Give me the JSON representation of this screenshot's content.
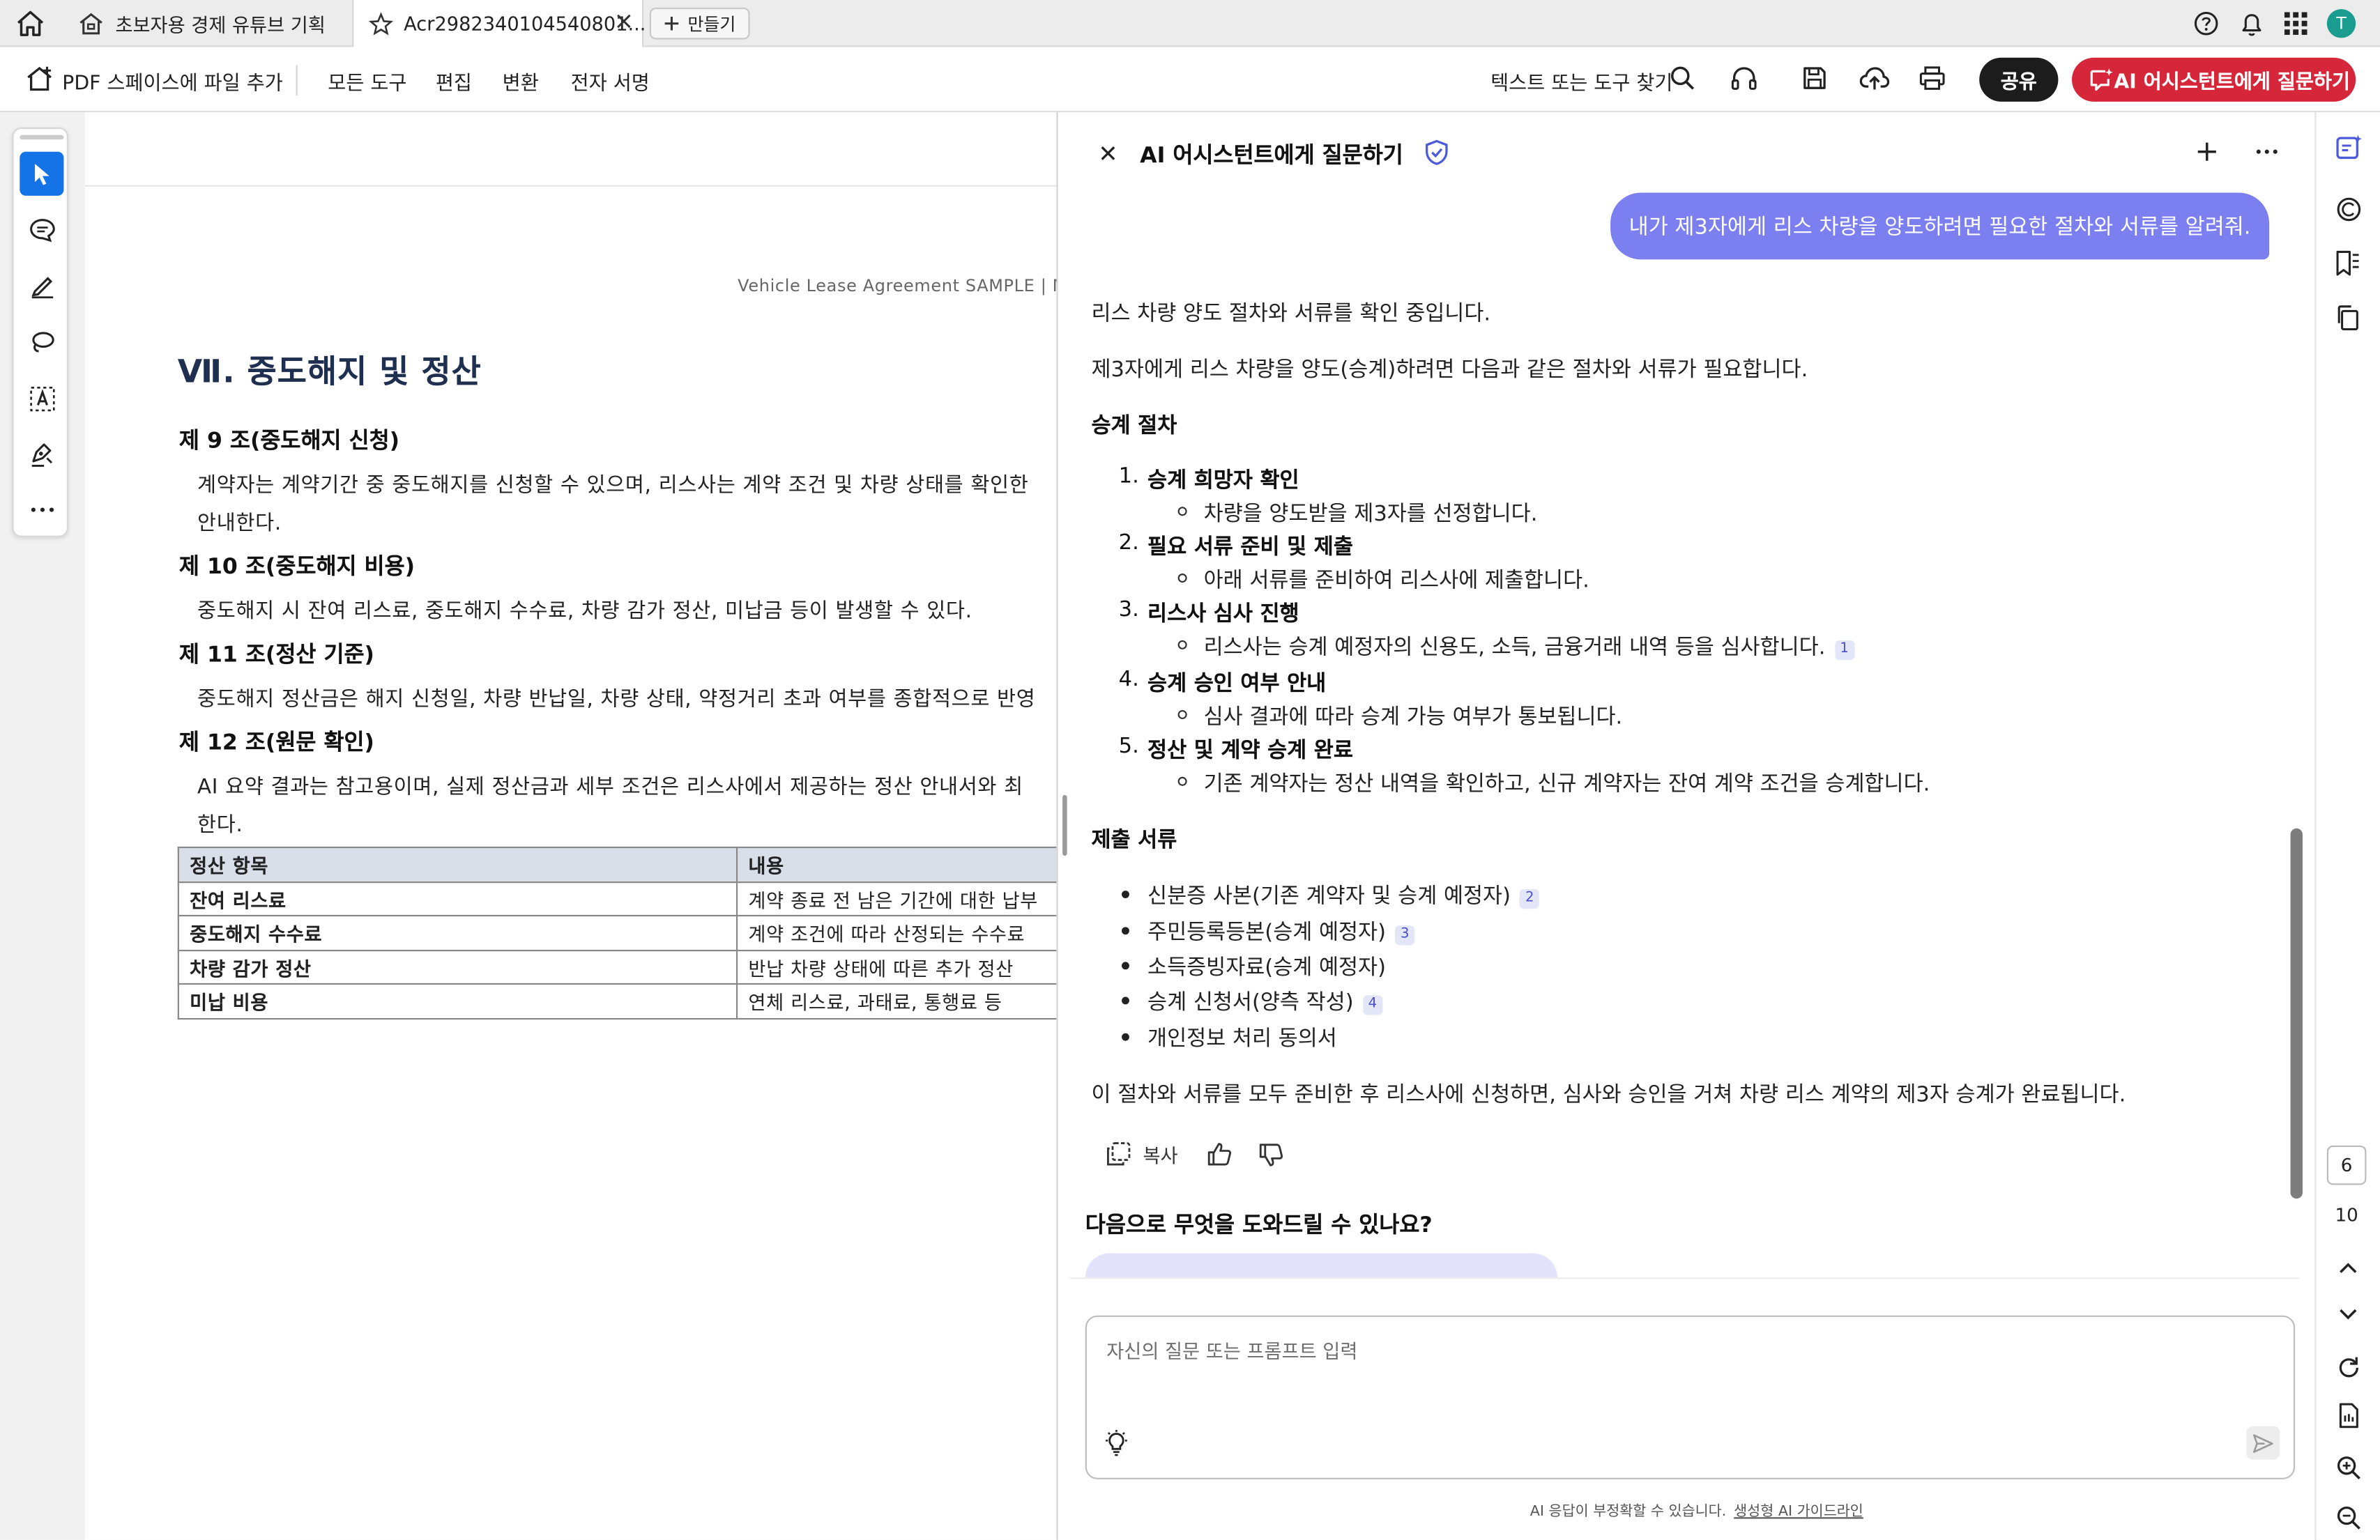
{
  "tabs": {
    "tab1_label": "초보자용 경제 유튜브 기획",
    "tab2_label": "Acr2982340104540801...",
    "new_tab_label": "만들기",
    "avatar_letter": "T"
  },
  "toolbar": {
    "add_to_space": "PDF 스페이스에 파일 추가",
    "menu": [
      "모든 도구",
      "편집",
      "변환",
      "전자 서명"
    ],
    "search_label": "텍스트 또는 도구 찾기",
    "share_label": "공유",
    "ai_button_label": "AI 어시스턴트에게 질문하기",
    "ai_button_color": "#d5263a"
  },
  "document": {
    "header": "Vehicle Lease Agreement SAMPLE | Merc",
    "section_title": "Ⅶ. 중도해지 및 정산",
    "articles": [
      {
        "title": "제 9 조(중도해지 신청)",
        "lines": [
          "계약자는 계약기간 중 중도해지를 신청할 수 있으며, 리스사는 계약 조건 및 차량 상태를 확인한",
          "안내한다."
        ]
      },
      {
        "title": "제 10 조(중도해지 비용)",
        "lines": [
          "중도해지 시 잔여 리스료, 중도해지 수수료, 차량 감가 정산, 미납금 등이 발생할 수 있다."
        ]
      },
      {
        "title": "제 11 조(정산 기준)",
        "lines": [
          "중도해지 정산금은 해지 신청일, 차량 반납일, 차량 상태, 약정거리 초과 여부를 종합적으로 반영"
        ]
      },
      {
        "title": "제 12 조(원문 확인)",
        "lines": [
          "AI 요약 결과는 참고용이며, 실제 정산금과 세부 조건은 리스사에서 제공하는 정산 안내서와 최",
          "한다."
        ]
      }
    ],
    "table": {
      "headers": [
        "정산 항목",
        "내용"
      ],
      "rows": [
        [
          "잔여 리스료",
          "계약 종료 전 남은 기간에 대한 납부"
        ],
        [
          "중도해지 수수료",
          "계약 조건에 따라 산정되는 수수료"
        ],
        [
          "차량 감가 정산",
          "반납 차량 상태에 따른 추가 정산"
        ],
        [
          "미납 비용",
          "연체 리스료, 과태료, 통행료 등"
        ]
      ]
    }
  },
  "ai_panel": {
    "title": "AI 어시스턴트에게 질문하기",
    "user_message": "내가 제3자에게 리스 차량을 양도하려면 필요한 절차와 서류를 알려줘.",
    "status": "리스 차량 양도 절차와 서류를 확인 중입니다.",
    "intro": "제3자에게 리스 차량을 양도(승계)하려면 다음과 같은 절차와 서류가 필요합니다.",
    "procedure_heading": "승계 절차",
    "steps": [
      {
        "num": "1.",
        "title": "승계 희망자 확인",
        "detail": "차량을 양도받을 제3자를 선정합니다.",
        "cite": ""
      },
      {
        "num": "2.",
        "title": "필요 서류 준비 및 제출",
        "detail": "아래 서류를 준비하여 리스사에 제출합니다.",
        "cite": ""
      },
      {
        "num": "3.",
        "title": "리스사 심사 진행",
        "detail": "리스사는 승계 예정자의 신용도, 소득, 금융거래 내역 등을 심사합니다.",
        "cite": "1"
      },
      {
        "num": "4.",
        "title": "승계 승인 여부 안내",
        "detail": "심사 결과에 따라 승계 가능 여부가 통보됩니다.",
        "cite": ""
      },
      {
        "num": "5.",
        "title": "정산 및 계약 승계 완료",
        "detail": "기존 계약자는 정산 내역을 확인하고, 신규 계약자는 잔여 계약 조건을 승계합니다.",
        "cite": ""
      }
    ],
    "documents_heading": "제출 서류",
    "documents": [
      {
        "text": "신분증 사본(기존 계약자 및 승계 예정자)",
        "cite": "2"
      },
      {
        "text": "주민등록등본(승계 예정자)",
        "cite": "3"
      },
      {
        "text": "소득증빙자료(승계 예정자)",
        "cite": ""
      },
      {
        "text": "승계 신청서(양측 작성)",
        "cite": "4"
      },
      {
        "text": "개인정보 처리 동의서",
        "cite": ""
      }
    ],
    "conclusion": "이 절차와 서류를 모두 준비한 후 리스사에 신청하면, 심사와 승인을 거쳐 차량 리스 계약의 제3자 승계가 완료됩니다.",
    "copy_label": "복사",
    "next_heading": "다음으로 무엇을 도와드릴 수 있나요?",
    "input_placeholder": "자신의 질문 또는 프롬프트 입력",
    "disclaimer": "AI 응답이 부정확할 수 있습니다.",
    "disclaimer_link": "생성형 AI 가이드라인",
    "user_bubble_color": "#7b7ff0"
  },
  "page_nav": {
    "current": "6",
    "total": "10"
  }
}
